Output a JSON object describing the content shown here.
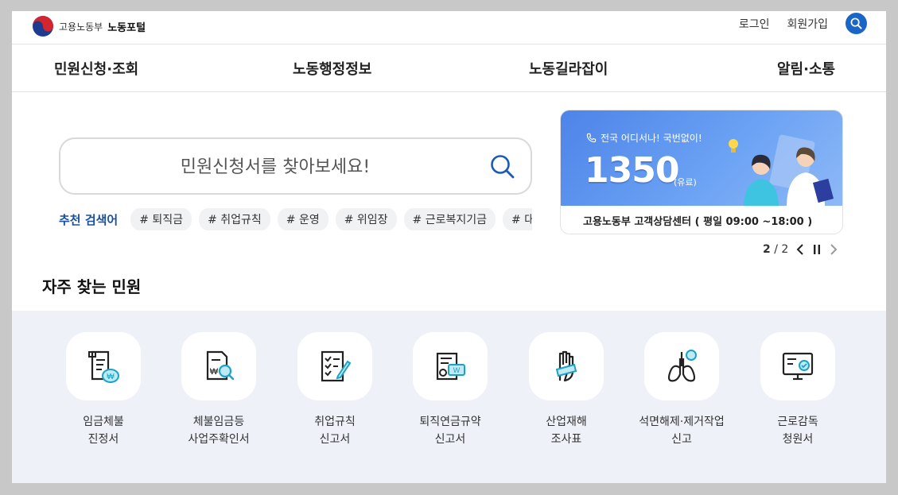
{
  "header": {
    "logo_org": "고용노동부",
    "logo_name": "노동포털",
    "login": "로그인",
    "signup": "회원가입"
  },
  "gnb": [
    "민원신청·조회",
    "노동행정정보",
    "노동길라잡이",
    "알림·소통"
  ],
  "search": {
    "placeholder": "민원신청서를 찾아보세요!",
    "recommend_label": "추천 검색어",
    "tags": [
      "# 퇴직금",
      "# 취업규칙",
      "# 운영",
      "# 위임장",
      "# 근로복지기금",
      "# 대지급"
    ]
  },
  "banner": {
    "subtitle": "전국 어디서나! 국번없이!",
    "number": "1350",
    "paid": "(유료)",
    "caption": "고용노동부 고객상담센터 ( 평일 09:00 ~18:00 )"
  },
  "pager": {
    "current": "2",
    "total": "/ 2"
  },
  "frequent": {
    "title": "자주 찾는 민원",
    "items": [
      {
        "line1": "임금체불",
        "line2": "진정서",
        "icon": "wage-document-icon"
      },
      {
        "line1": "체불임금등",
        "line2": "사업주확인서",
        "icon": "document-search-icon"
      },
      {
        "line1": "취업규칙",
        "line2": "신고서",
        "icon": "checklist-icon"
      },
      {
        "line1": "퇴직연금규약",
        "line2": "신고서",
        "icon": "pension-certificate-icon"
      },
      {
        "line1": "산업재해",
        "line2": "조사표",
        "icon": "injured-hand-icon"
      },
      {
        "line1": "석면해제·제거작업",
        "line2": "신고",
        "icon": "lungs-icon"
      },
      {
        "line1": "근로감독",
        "line2": "청원서",
        "icon": "monitor-icon"
      }
    ]
  },
  "colors": {
    "primary": "#1a66c7",
    "label": "#1a4fa0",
    "accent": "#1ba3c6",
    "section_bg": "#eef1f7"
  }
}
